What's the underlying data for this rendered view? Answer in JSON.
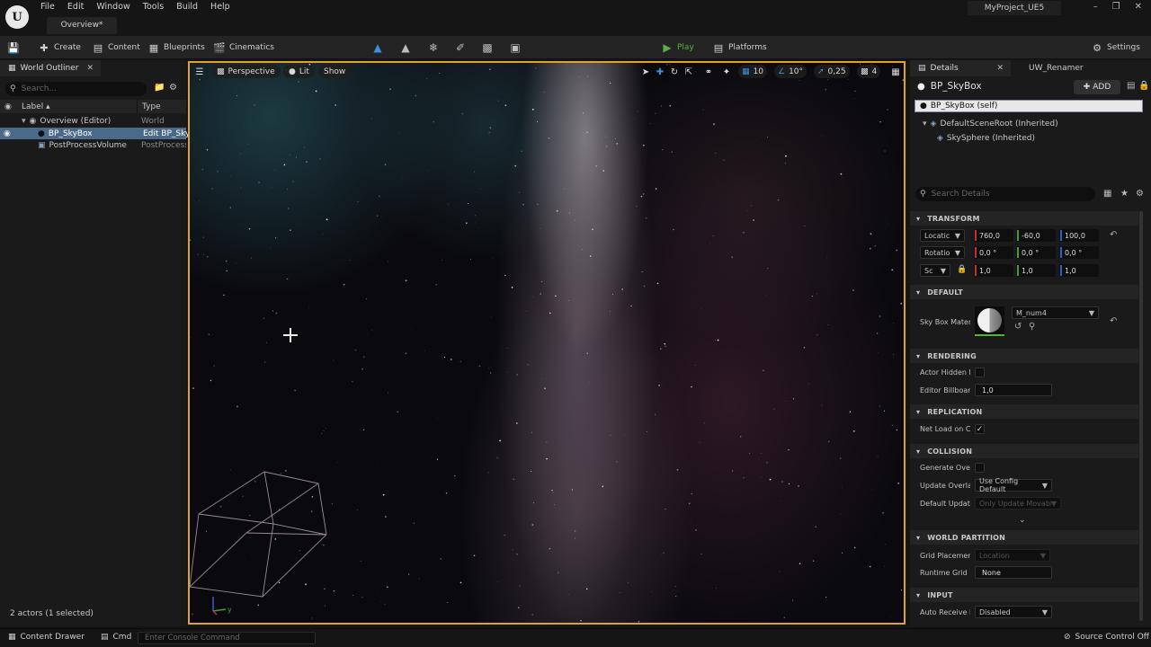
{
  "menu": {
    "logo_letter": "U",
    "items": [
      "File",
      "Edit",
      "Window",
      "Tools",
      "Build",
      "Help"
    ],
    "doc_tab": "Overview*",
    "project": "MyProject_UE5"
  },
  "toolbar": {
    "create": "Create",
    "content": "Content",
    "blueprints": "Blueprints",
    "cinematics": "Cinematics",
    "play": "Play",
    "platforms": "Platforms",
    "settings": "Settings"
  },
  "outliner": {
    "tab": "World Outliner",
    "search_placeholder": "Search...",
    "col_label": "Label ▴",
    "col_type": "Type",
    "rows": [
      {
        "label": "Overview (Editor)",
        "type": "World"
      },
      {
        "label": "BP_SkyBox",
        "type": "Edit BP_SkyBox"
      },
      {
        "label": "PostProcessVolume",
        "type": "PostProcessVolume"
      }
    ],
    "footer": "2 actors (1 selected)"
  },
  "viewport": {
    "perspective": "Perspective",
    "lit": "Lit",
    "show": "Show",
    "grid_snap": "10",
    "rot_snap": "10°",
    "scale_snap": "0,25",
    "cam_speed": "4"
  },
  "details": {
    "tab": "Details",
    "tab2": "UW_Renamer",
    "actor": "BP_SkyBox",
    "add": "ADD",
    "self": "BP_SkyBox  (self)",
    "root": "DefaultSceneRoot (Inherited)",
    "sphere": "SkySphere (Inherited)",
    "search_placeholder": "Search Details",
    "transform": {
      "title": "TRANSFORM",
      "loc_label": "Locatic",
      "rot_label": "Rotatio",
      "scale_label": "Sc",
      "loc": [
        "760,0",
        "-60,0",
        "100,0"
      ],
      "rot": [
        "0,0 °",
        "0,0 °",
        "0,0 °"
      ],
      "scale": [
        "1,0",
        "1,0",
        "1,0"
      ]
    },
    "default": {
      "title": "DEFAULT",
      "label": "Sky Box Mater",
      "material": "M_num4"
    },
    "rendering": {
      "title": "RENDERING",
      "hidden_label": "Actor Hidden Ir",
      "billboard_label": "Editor Billboarc",
      "billboard_value": "1,0"
    },
    "replication": {
      "title": "REPLICATION",
      "net_label": "Net Load on Cl"
    },
    "collision": {
      "title": "COLLISION",
      "gen_label": "Generate Overl",
      "upd_label": "Update Overlap",
      "upd_value": "Use Config Default",
      "def_label": "Default Update",
      "def_value": "Only Update Movable"
    },
    "world_partition": {
      "title": "WORLD PARTITION",
      "grid_label": "Grid Placemen",
      "grid_value": "Location",
      "runtime_label": "Runtime Grid",
      "runtime_value": "None"
    },
    "input": {
      "title": "INPUT",
      "auto_label": "Auto Receive Ir",
      "auto_value": "Disabled"
    }
  },
  "status": {
    "content_drawer": "Content Drawer",
    "cmd": "Cmd",
    "console_placeholder": "Enter Console Command",
    "source_control": "Source Control Off"
  },
  "colors": {
    "accent_orange": "#e0a22a",
    "play_green": "#5ab03c",
    "x_red": "#c23030",
    "y_green": "#4a9a3a",
    "z_blue": "#3060c0"
  }
}
